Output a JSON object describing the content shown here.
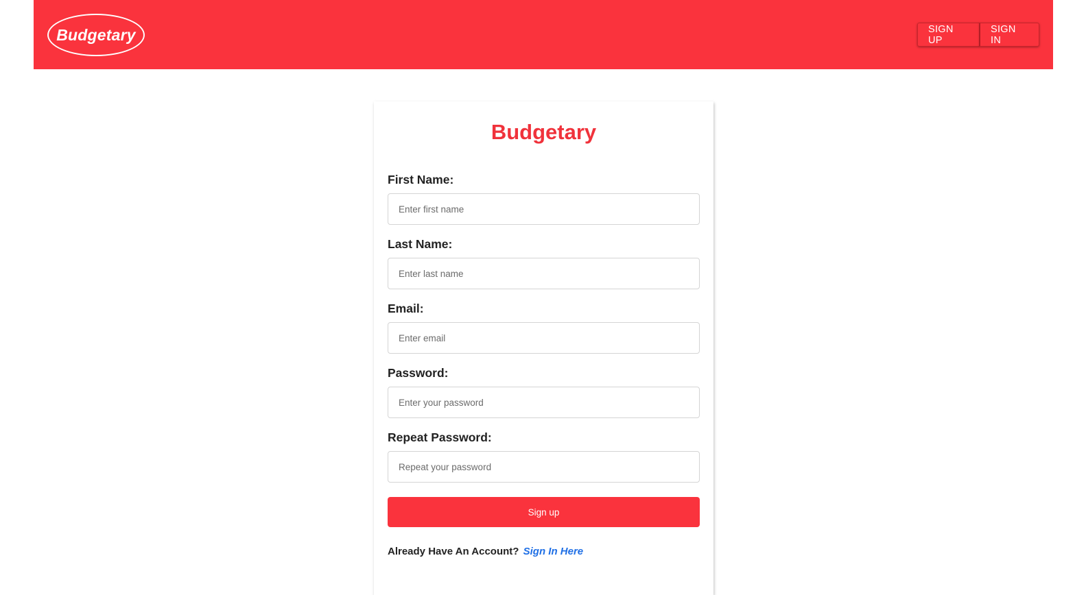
{
  "navbar": {
    "logo_text": "Budgetary",
    "sign_up_label": "SIGN UP",
    "sign_in_label": "SIGN IN",
    "background_color": "#fa333d"
  },
  "form": {
    "title": "Budgetary",
    "fields": [
      {
        "label": "First Name:",
        "placeholder": "Enter first name",
        "value": ""
      },
      {
        "label": "Last Name:",
        "placeholder": "Enter last name",
        "value": ""
      },
      {
        "label": "Email:",
        "placeholder": "Enter email",
        "value": ""
      },
      {
        "label": "Password:",
        "placeholder": "Enter your password",
        "value": ""
      },
      {
        "label": "Repeat Password:",
        "placeholder": "Repeat your password",
        "value": ""
      }
    ],
    "submit_label": "Sign up",
    "footer_text": "Already Have An Account?",
    "footer_link": "Sign In Here",
    "accent_color": "#fa333d",
    "link_color": "#1f6fe5"
  }
}
